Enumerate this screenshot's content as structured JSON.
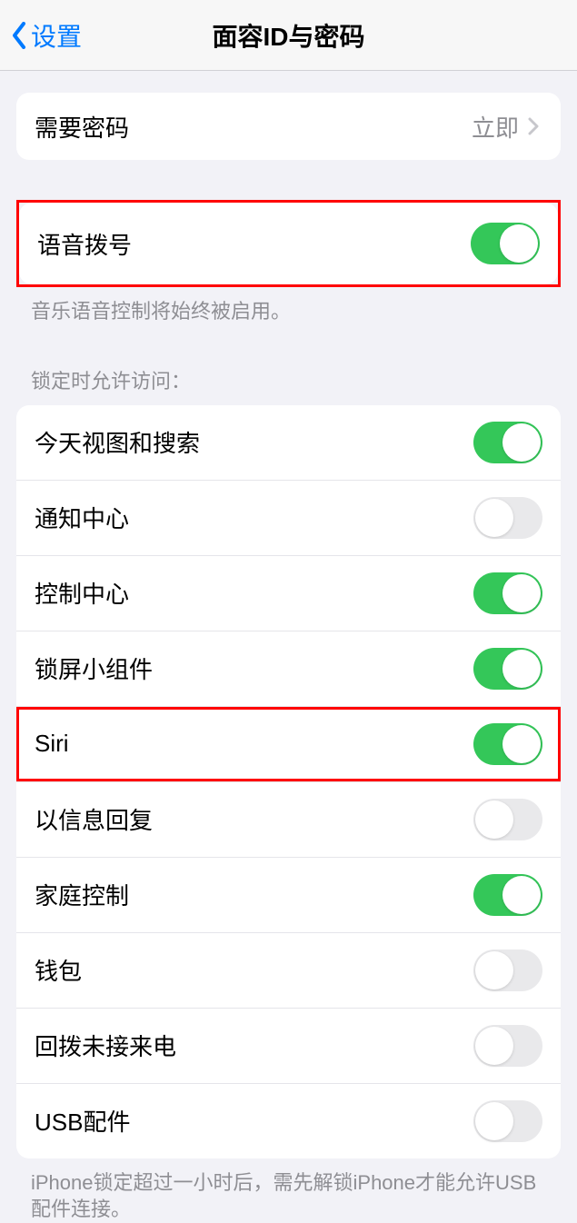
{
  "nav": {
    "back_label": "设置",
    "title": "面容ID与密码"
  },
  "passcode": {
    "label": "需要密码",
    "value": "立即"
  },
  "voice_dial": {
    "label": "语音拨号",
    "footer": "音乐语音控制将始终被启用。",
    "on": true
  },
  "locked_access_header": "锁定时允许访问：",
  "items": [
    {
      "label": "今天视图和搜索",
      "on": true
    },
    {
      "label": "通知中心",
      "on": false
    },
    {
      "label": "控制中心",
      "on": true
    },
    {
      "label": "锁屏小组件",
      "on": true
    },
    {
      "label": "Siri",
      "on": true
    },
    {
      "label": "以信息回复",
      "on": false
    },
    {
      "label": "家庭控制",
      "on": true
    },
    {
      "label": "钱包",
      "on": false
    },
    {
      "label": "回拨未接来电",
      "on": false
    },
    {
      "label": "USB配件",
      "on": false
    }
  ],
  "usb_footer": "iPhone锁定超过一小时后，需先解锁iPhone才能允许USB配件连接。"
}
